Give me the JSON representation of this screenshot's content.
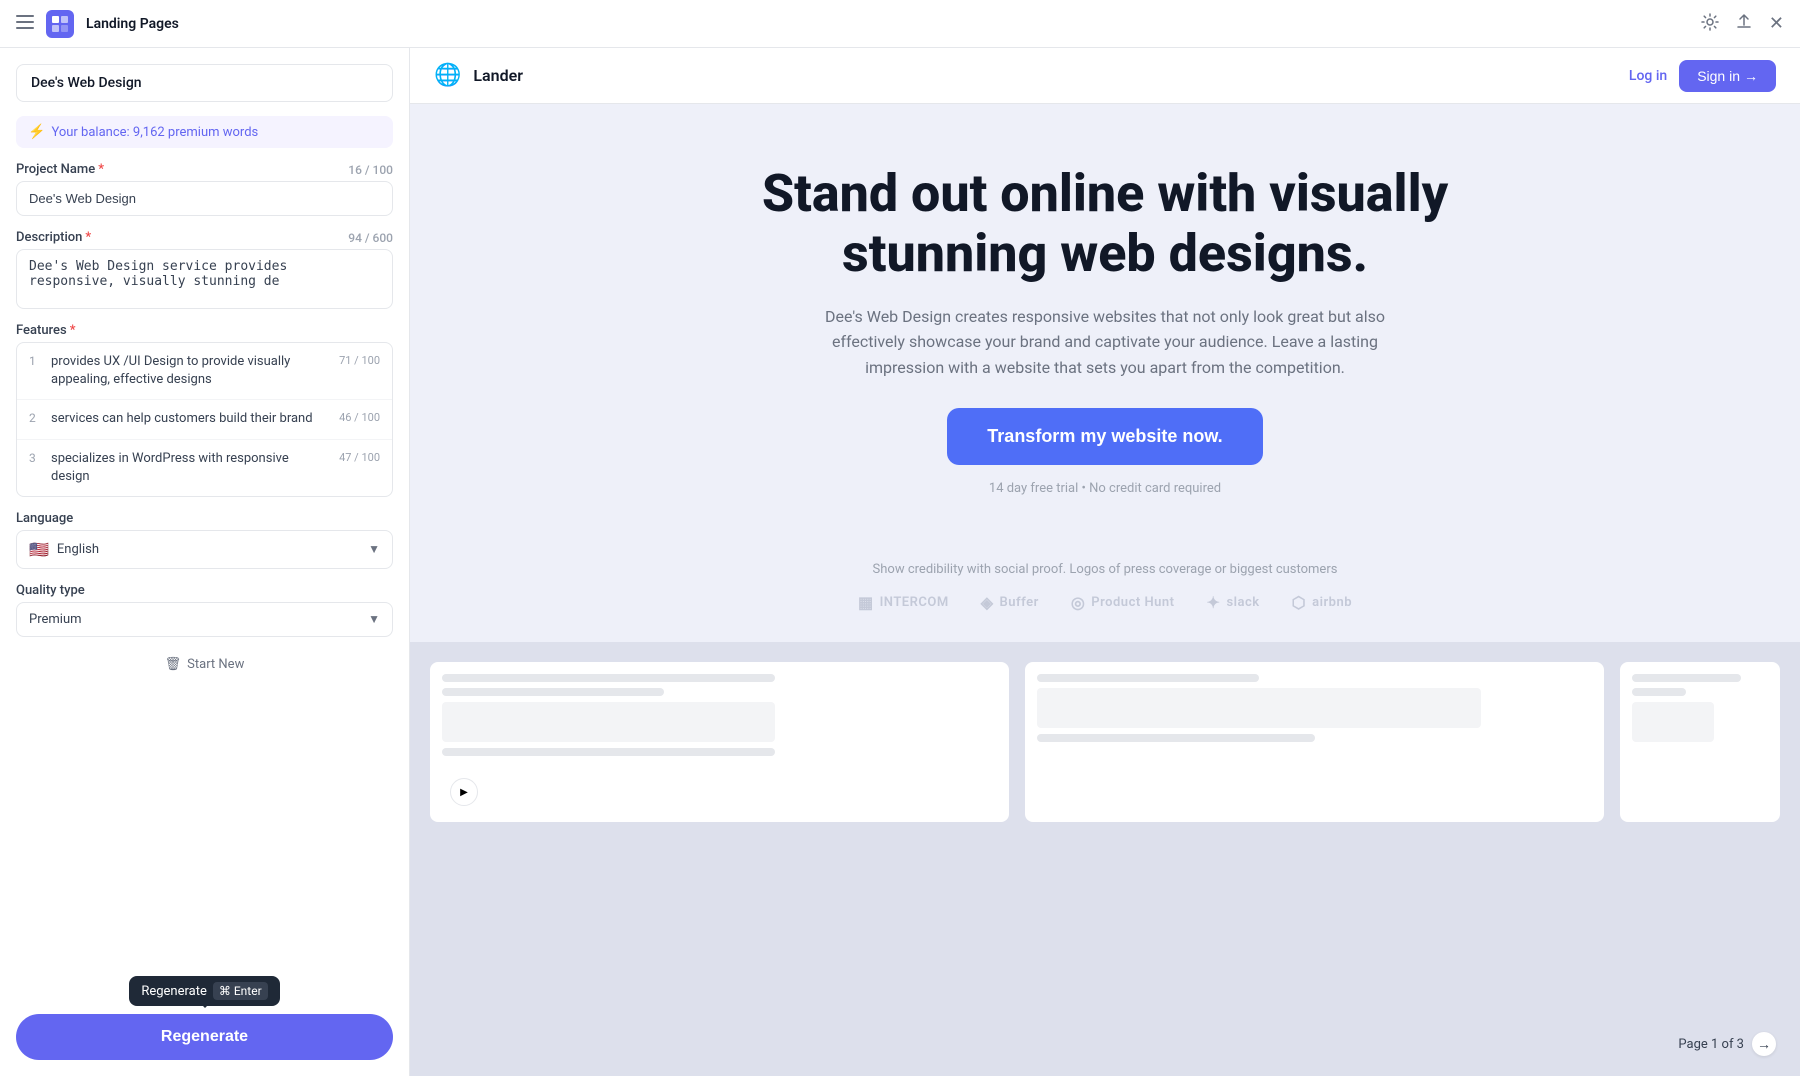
{
  "titlebar": {
    "title": "Landing Pages",
    "icons": {
      "menu": "☰",
      "settings": "⚙",
      "share": "↑",
      "close": "✕"
    }
  },
  "sidebar": {
    "project_display": "Dee's Web Design",
    "balance_label": "Your balance: 9,162 premium words",
    "balance_icon": "⚡",
    "project_name_label": "Project Name",
    "project_name_required": "*",
    "project_name_counter": "16 / 100",
    "project_name_value": "Dee's Web Design",
    "description_label": "Description",
    "description_required": "*",
    "description_counter": "94 / 600",
    "description_value": "Dee's Web Design service provides responsive, visually stunning de",
    "features_label": "Features",
    "features_required": "*",
    "features": [
      {
        "num": "1",
        "text": "provides UX /UI Design to provide visually appealing, effective designs",
        "counter": "71 / 100"
      },
      {
        "num": "2",
        "text": "services can help customers build their brand",
        "counter": "46 / 100"
      },
      {
        "num": "3",
        "text": "specializes in WordPress with responsive design",
        "counter": "47 / 100"
      }
    ],
    "language_label": "Language",
    "language_value": "English",
    "language_flag": "🇺🇸",
    "quality_label": "Quality type",
    "quality_value": "Premium",
    "start_new_label": "Start New",
    "regenerate_label": "Regenerate"
  },
  "tooltip": {
    "label": "Regenerate",
    "key": "⌘",
    "enter": "Enter"
  },
  "preview": {
    "nav": {
      "globe": "🌐",
      "brand": "Lander",
      "login_label": "Log in",
      "signup_label": "Sign in",
      "signup_arrow": "→"
    },
    "hero": {
      "title": "Stand out online with visually stunning web designs.",
      "subtitle": "Dee's Web Design creates responsive websites that not only look great but also effectively showcase your brand and captivate your audience. Leave a lasting impression with a website that sets you apart from the competition.",
      "cta_label": "Transform my website now.",
      "fine_print": "14 day free trial • No credit card required"
    },
    "social_proof": {
      "label": "Show credibility with social proof. Logos of press coverage or biggest customers",
      "logos": [
        {
          "icon": "▦",
          "name": "INTERCOM"
        },
        {
          "icon": "◈",
          "name": "Buffer"
        },
        {
          "icon": "◎",
          "name": "Product Hunt"
        },
        {
          "icon": "✦",
          "name": "slack"
        },
        {
          "icon": "⬡",
          "name": "airbnb"
        }
      ]
    },
    "pagination": {
      "label": "Page 1 of 3",
      "next": "→"
    }
  }
}
